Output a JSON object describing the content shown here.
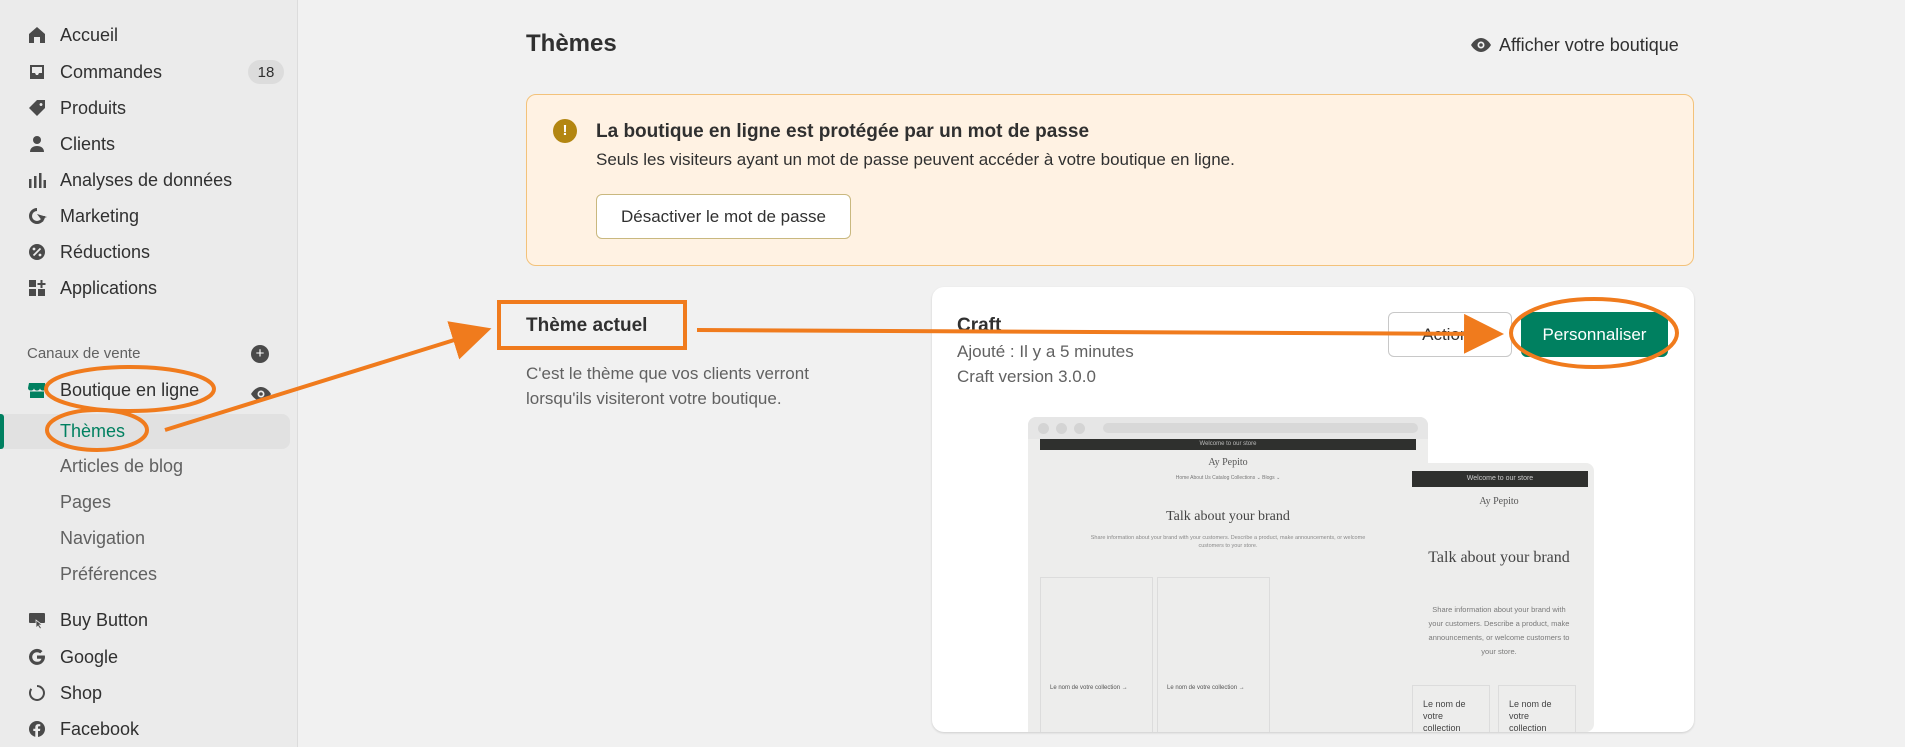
{
  "sidebar": {
    "items": [
      {
        "label": "Accueil",
        "icon": "home-icon"
      },
      {
        "label": "Commandes",
        "icon": "inbox-icon",
        "badge": "18"
      },
      {
        "label": "Produits",
        "icon": "tag-icon"
      },
      {
        "label": "Clients",
        "icon": "person-icon"
      },
      {
        "label": "Analyses de données",
        "icon": "bar-chart-icon"
      },
      {
        "label": "Marketing",
        "icon": "target-icon"
      },
      {
        "label": "Réductions",
        "icon": "discount-icon"
      },
      {
        "label": "Applications",
        "icon": "apps-icon"
      }
    ],
    "sales_channels_label": "Canaux de vente",
    "online_store": {
      "label": "Boutique en ligne",
      "subitems": [
        "Thèmes",
        "Articles de blog",
        "Pages",
        "Navigation",
        "Préférences"
      ],
      "active": "Thèmes"
    },
    "channels": [
      {
        "label": "Buy Button",
        "icon": "buy-button-icon"
      },
      {
        "label": "Google",
        "icon": "google-icon"
      },
      {
        "label": "Shop",
        "icon": "shop-icon"
      },
      {
        "label": "Facebook",
        "icon": "facebook-icon"
      }
    ]
  },
  "header": {
    "title": "Thèmes",
    "view_store": "Afficher votre boutique"
  },
  "banner": {
    "title": "La boutique en ligne est protégée par un mot de passe",
    "text": "Seuls les visiteurs ayant un mot de passe peuvent accéder à votre boutique en ligne.",
    "button": "Désactiver le mot de passe"
  },
  "current_theme": {
    "heading": "Thème actuel",
    "description": "C'est le thème que vos clients verront lorsqu'ils visiteront votre boutique."
  },
  "theme_card": {
    "name": "Craft",
    "added": "Ajouté : Il y a 5 minutes",
    "version": "Craft version 3.0.0",
    "actions_label": "Actions",
    "customize_label": "Personnaliser",
    "preview": {
      "announce": "Welcome to our store",
      "logo": "Ay Pepito",
      "nav": "Home   About Us   Catalog   Collections ⌄   Blogs ⌄",
      "heading": "Talk about your brand",
      "text": "Share information about your brand with your customers. Describe a product, make announcements, or welcome customers to your store.",
      "collection": "Le nom de votre collection →",
      "mobile_collection": "Le nom de votre collection"
    }
  },
  "colors": {
    "accent": "#008060",
    "annotation": "#f07b1d",
    "banner_bg": "#fff2e3"
  }
}
